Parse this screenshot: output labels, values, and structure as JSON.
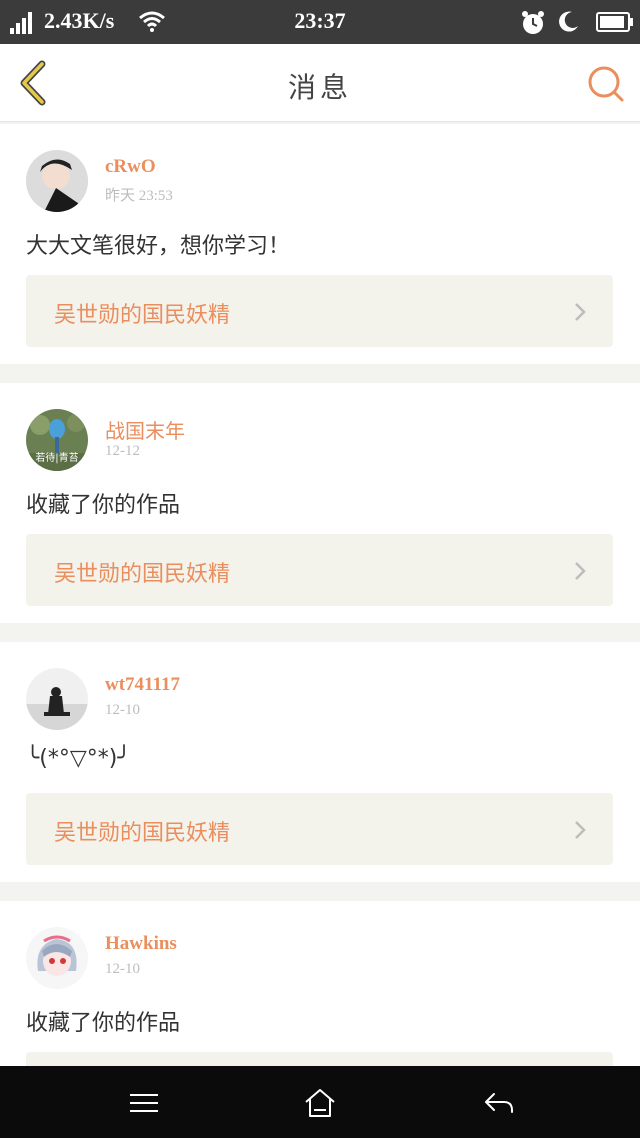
{
  "status_bar": {
    "net_speed": "2.43K/s",
    "time": "23:37",
    "icons": [
      "signal-icon",
      "wifi-icon",
      "alarm-icon",
      "moon-icon",
      "battery-icon"
    ]
  },
  "navbar": {
    "title": "消息",
    "back_icon": "chevron-left-icon",
    "search_icon": "search-icon",
    "accent_color": "#ea8e5d",
    "back_color": "#e8c84a"
  },
  "messages": [
    {
      "user": "cRwO",
      "time": "昨天 23:53",
      "text": "大大文笔很好，想你学习！",
      "work_title": "吴世勋的国民妖精"
    },
    {
      "user": "战国末年",
      "time": "12-12",
      "text": "收藏了你的作品",
      "work_title": "吴世勋的国民妖精",
      "avatar_text": "若待|青苔"
    },
    {
      "user": "wt741117",
      "time": "12-10",
      "text": "╰(*°▽°*)╯",
      "work_title": "吴世勋的国民妖精"
    },
    {
      "user": "Hawkins",
      "time": "12-10",
      "text": "收藏了你的作品",
      "work_title": ""
    }
  ],
  "system_bar": {
    "icons": [
      "menu-icon",
      "home-icon",
      "back-icon"
    ]
  }
}
